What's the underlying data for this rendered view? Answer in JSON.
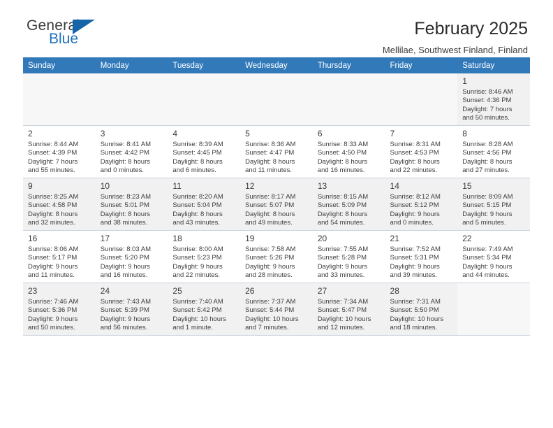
{
  "brand": {
    "word_one": "General",
    "word_two": "Blue",
    "logo_icon": "triangle-logo-icon",
    "accent_color": "#1f73bd"
  },
  "header": {
    "title": "February 2025",
    "subtitle": "Mellilae, Southwest Finland, Finland"
  },
  "theme": {
    "header_row_bg": "#3279ba",
    "header_row_text": "#ffffff",
    "shade_row_bg": "#f1f1f1",
    "plain_row_bg": "#ffffff",
    "empty_cell_bg": "#f7f7f7",
    "cell_border": "#c9d3dc"
  },
  "calendar": {
    "columns": [
      "Sunday",
      "Monday",
      "Tuesday",
      "Wednesday",
      "Thursday",
      "Friday",
      "Saturday"
    ],
    "weeks": [
      [
        {
          "day": "",
          "detail": "",
          "empty": true
        },
        {
          "day": "",
          "detail": "",
          "empty": true
        },
        {
          "day": "",
          "detail": "",
          "empty": true
        },
        {
          "day": "",
          "detail": "",
          "empty": true
        },
        {
          "day": "",
          "detail": "",
          "empty": true
        },
        {
          "day": "",
          "detail": "",
          "empty": true
        },
        {
          "day": "1",
          "sunrise": "8:46 AM",
          "sunset": "4:36 PM",
          "daylight": "7 hours and 50 minutes.",
          "detail": "Sunrise: 8:46 AM\nSunset: 4:36 PM\nDaylight: 7 hours\nand 50 minutes."
        }
      ],
      [
        {
          "day": "2",
          "sunrise": "8:44 AM",
          "sunset": "4:39 PM",
          "daylight": "7 hours and 55 minutes.",
          "detail": "Sunrise: 8:44 AM\nSunset: 4:39 PM\nDaylight: 7 hours\nand 55 minutes."
        },
        {
          "day": "3",
          "sunrise": "8:41 AM",
          "sunset": "4:42 PM",
          "daylight": "8 hours and 0 minutes.",
          "detail": "Sunrise: 8:41 AM\nSunset: 4:42 PM\nDaylight: 8 hours\nand 0 minutes."
        },
        {
          "day": "4",
          "sunrise": "8:39 AM",
          "sunset": "4:45 PM",
          "daylight": "8 hours and 6 minutes.",
          "detail": "Sunrise: 8:39 AM\nSunset: 4:45 PM\nDaylight: 8 hours\nand 6 minutes."
        },
        {
          "day": "5",
          "sunrise": "8:36 AM",
          "sunset": "4:47 PM",
          "daylight": "8 hours and 11 minutes.",
          "detail": "Sunrise: 8:36 AM\nSunset: 4:47 PM\nDaylight: 8 hours\nand 11 minutes."
        },
        {
          "day": "6",
          "sunrise": "8:33 AM",
          "sunset": "4:50 PM",
          "daylight": "8 hours and 16 minutes.",
          "detail": "Sunrise: 8:33 AM\nSunset: 4:50 PM\nDaylight: 8 hours\nand 16 minutes."
        },
        {
          "day": "7",
          "sunrise": "8:31 AM",
          "sunset": "4:53 PM",
          "daylight": "8 hours and 22 minutes.",
          "detail": "Sunrise: 8:31 AM\nSunset: 4:53 PM\nDaylight: 8 hours\nand 22 minutes."
        },
        {
          "day": "8",
          "sunrise": "8:28 AM",
          "sunset": "4:56 PM",
          "daylight": "8 hours and 27 minutes.",
          "detail": "Sunrise: 8:28 AM\nSunset: 4:56 PM\nDaylight: 8 hours\nand 27 minutes."
        }
      ],
      [
        {
          "day": "9",
          "sunrise": "8:25 AM",
          "sunset": "4:58 PM",
          "daylight": "8 hours and 32 minutes.",
          "detail": "Sunrise: 8:25 AM\nSunset: 4:58 PM\nDaylight: 8 hours\nand 32 minutes."
        },
        {
          "day": "10",
          "sunrise": "8:23 AM",
          "sunset": "5:01 PM",
          "daylight": "8 hours and 38 minutes.",
          "detail": "Sunrise: 8:23 AM\nSunset: 5:01 PM\nDaylight: 8 hours\nand 38 minutes."
        },
        {
          "day": "11",
          "sunrise": "8:20 AM",
          "sunset": "5:04 PM",
          "daylight": "8 hours and 43 minutes.",
          "detail": "Sunrise: 8:20 AM\nSunset: 5:04 PM\nDaylight: 8 hours\nand 43 minutes."
        },
        {
          "day": "12",
          "sunrise": "8:17 AM",
          "sunset": "5:07 PM",
          "daylight": "8 hours and 49 minutes.",
          "detail": "Sunrise: 8:17 AM\nSunset: 5:07 PM\nDaylight: 8 hours\nand 49 minutes."
        },
        {
          "day": "13",
          "sunrise": "8:15 AM",
          "sunset": "5:09 PM",
          "daylight": "8 hours and 54 minutes.",
          "detail": "Sunrise: 8:15 AM\nSunset: 5:09 PM\nDaylight: 8 hours\nand 54 minutes."
        },
        {
          "day": "14",
          "sunrise": "8:12 AM",
          "sunset": "5:12 PM",
          "daylight": "9 hours and 0 minutes.",
          "detail": "Sunrise: 8:12 AM\nSunset: 5:12 PM\nDaylight: 9 hours\nand 0 minutes."
        },
        {
          "day": "15",
          "sunrise": "8:09 AM",
          "sunset": "5:15 PM",
          "daylight": "9 hours and 5 minutes.",
          "detail": "Sunrise: 8:09 AM\nSunset: 5:15 PM\nDaylight: 9 hours\nand 5 minutes."
        }
      ],
      [
        {
          "day": "16",
          "sunrise": "8:06 AM",
          "sunset": "5:17 PM",
          "daylight": "9 hours and 11 minutes.",
          "detail": "Sunrise: 8:06 AM\nSunset: 5:17 PM\nDaylight: 9 hours\nand 11 minutes."
        },
        {
          "day": "17",
          "sunrise": "8:03 AM",
          "sunset": "5:20 PM",
          "daylight": "9 hours and 16 minutes.",
          "detail": "Sunrise: 8:03 AM\nSunset: 5:20 PM\nDaylight: 9 hours\nand 16 minutes."
        },
        {
          "day": "18",
          "sunrise": "8:00 AM",
          "sunset": "5:23 PM",
          "daylight": "9 hours and 22 minutes.",
          "detail": "Sunrise: 8:00 AM\nSunset: 5:23 PM\nDaylight: 9 hours\nand 22 minutes."
        },
        {
          "day": "19",
          "sunrise": "7:58 AM",
          "sunset": "5:26 PM",
          "daylight": "9 hours and 28 minutes.",
          "detail": "Sunrise: 7:58 AM\nSunset: 5:26 PM\nDaylight: 9 hours\nand 28 minutes."
        },
        {
          "day": "20",
          "sunrise": "7:55 AM",
          "sunset": "5:28 PM",
          "daylight": "9 hours and 33 minutes.",
          "detail": "Sunrise: 7:55 AM\nSunset: 5:28 PM\nDaylight: 9 hours\nand 33 minutes."
        },
        {
          "day": "21",
          "sunrise": "7:52 AM",
          "sunset": "5:31 PM",
          "daylight": "9 hours and 39 minutes.",
          "detail": "Sunrise: 7:52 AM\nSunset: 5:31 PM\nDaylight: 9 hours\nand 39 minutes."
        },
        {
          "day": "22",
          "sunrise": "7:49 AM",
          "sunset": "5:34 PM",
          "daylight": "9 hours and 44 minutes.",
          "detail": "Sunrise: 7:49 AM\nSunset: 5:34 PM\nDaylight: 9 hours\nand 44 minutes."
        }
      ],
      [
        {
          "day": "23",
          "sunrise": "7:46 AM",
          "sunset": "5:36 PM",
          "daylight": "9 hours and 50 minutes.",
          "detail": "Sunrise: 7:46 AM\nSunset: 5:36 PM\nDaylight: 9 hours\nand 50 minutes."
        },
        {
          "day": "24",
          "sunrise": "7:43 AM",
          "sunset": "5:39 PM",
          "daylight": "9 hours and 56 minutes.",
          "detail": "Sunrise: 7:43 AM\nSunset: 5:39 PM\nDaylight: 9 hours\nand 56 minutes."
        },
        {
          "day": "25",
          "sunrise": "7:40 AM",
          "sunset": "5:42 PM",
          "daylight": "10 hours and 1 minute.",
          "detail": "Sunrise: 7:40 AM\nSunset: 5:42 PM\nDaylight: 10 hours\nand 1 minute."
        },
        {
          "day": "26",
          "sunrise": "7:37 AM",
          "sunset": "5:44 PM",
          "daylight": "10 hours and 7 minutes.",
          "detail": "Sunrise: 7:37 AM\nSunset: 5:44 PM\nDaylight: 10 hours\nand 7 minutes."
        },
        {
          "day": "27",
          "sunrise": "7:34 AM",
          "sunset": "5:47 PM",
          "daylight": "10 hours and 12 minutes.",
          "detail": "Sunrise: 7:34 AM\nSunset: 5:47 PM\nDaylight: 10 hours\nand 12 minutes."
        },
        {
          "day": "28",
          "sunrise": "7:31 AM",
          "sunset": "5:50 PM",
          "daylight": "10 hours and 18 minutes.",
          "detail": "Sunrise: 7:31 AM\nSunset: 5:50 PM\nDaylight: 10 hours\nand 18 minutes."
        },
        {
          "day": "",
          "detail": "",
          "empty": true
        }
      ]
    ]
  }
}
